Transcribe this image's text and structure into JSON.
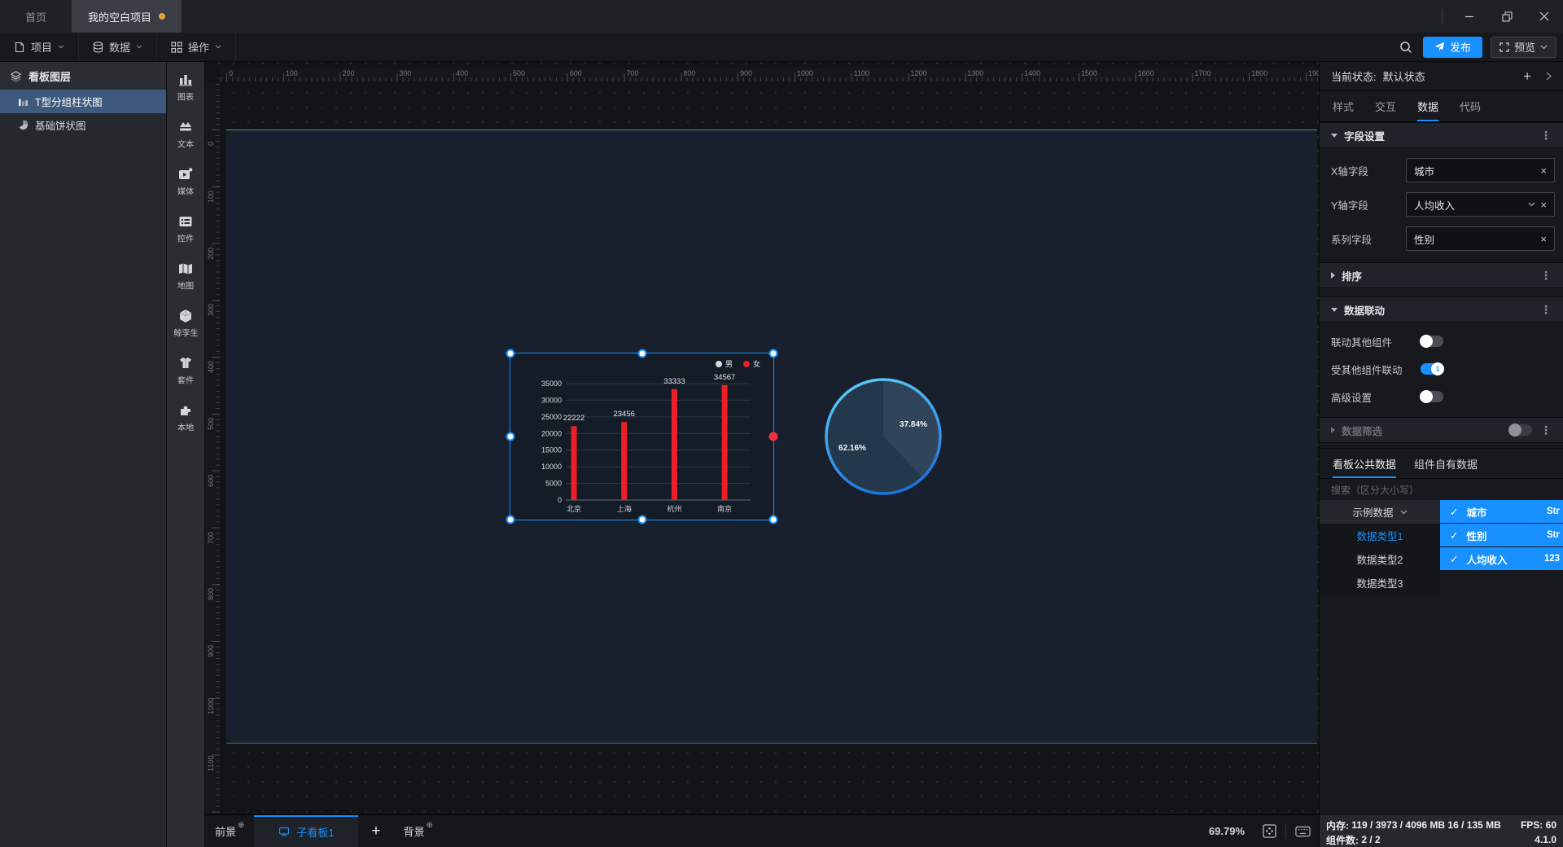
{
  "titlebar": {
    "home_tab": "首页",
    "project_tab": "我的空白项目"
  },
  "menubar": {
    "items": [
      {
        "key": "project",
        "label": "项目"
      },
      {
        "key": "data",
        "label": "数据"
      },
      {
        "key": "ops",
        "label": "操作"
      }
    ],
    "publish": "发布",
    "preview": "预览"
  },
  "layers_panel": {
    "title": "看板图层",
    "items": [
      {
        "label": "T型分组柱状图",
        "selected": true
      },
      {
        "label": "基础饼状图",
        "selected": false
      }
    ]
  },
  "component_strip": {
    "items": [
      {
        "key": "chart",
        "label": "图表"
      },
      {
        "key": "text",
        "label": "文本"
      },
      {
        "key": "media",
        "label": "媒体"
      },
      {
        "key": "control",
        "label": "控件"
      },
      {
        "key": "map",
        "label": "地图"
      },
      {
        "key": "twin",
        "label": "鲸孪生"
      },
      {
        "key": "kit",
        "label": "套件"
      },
      {
        "key": "local",
        "label": "本地"
      }
    ]
  },
  "canvas": {
    "ruler_h": {
      "start": 0,
      "end": 1900,
      "step": 100
    },
    "ruler_v": {
      "start": 0,
      "end": 1100,
      "step": 100
    },
    "scale": 0.6979
  },
  "chart_data": [
    {
      "type": "bar",
      "categories": [
        "北京",
        "上海",
        "杭州",
        "南京"
      ],
      "series": [
        {
          "name": "男",
          "color": "#d9d9d9",
          "values": []
        },
        {
          "name": "女",
          "color": "#ec1e28",
          "values": [
            22222,
            23456,
            33333,
            34567
          ]
        }
      ],
      "ylim": [
        0,
        35000
      ],
      "ytick_step": 5000,
      "legend_position": "top-right",
      "grid": true,
      "title": "",
      "xlabel": "",
      "ylabel": ""
    },
    {
      "type": "pie",
      "start_angle": -90,
      "slices": [
        {
          "label": "37.84%",
          "value": 37.84,
          "color": "#30455a"
        },
        {
          "label": "62.16%",
          "value": 62.16,
          "color": "#24384c"
        }
      ],
      "ring_gradient": [
        "#5dcdf6",
        "#1d74dd"
      ]
    }
  ],
  "board_bar": {
    "foreground": "前景",
    "active_tab": "子看板1",
    "add": "+",
    "background": "背景",
    "zoom": "69.79%"
  },
  "inspector": {
    "state": {
      "label": "当前状态:",
      "value": "默认状态"
    },
    "tabs": [
      {
        "label": "样式"
      },
      {
        "label": "交互"
      },
      {
        "label": "数据",
        "active": true
      },
      {
        "label": "代码"
      }
    ],
    "field_section": {
      "title": "字段设置",
      "fields": [
        {
          "label": "X轴字段",
          "value": "城市",
          "has_dropdown": false
        },
        {
          "label": "Y轴字段",
          "value": "人均收入",
          "has_dropdown": true
        },
        {
          "label": "系列字段",
          "value": "性别",
          "has_dropdown": false
        }
      ]
    },
    "sort_section": {
      "title": "排序"
    },
    "linkage_section": {
      "title": "数据联动",
      "toggles": [
        {
          "label": "联动其他组件",
          "on": false
        },
        {
          "label": "受其他组件联动",
          "on": true,
          "badge": "1"
        },
        {
          "label": "高级设置",
          "on": false
        }
      ]
    },
    "filter_section": {
      "title": "数据筛选",
      "disabled": true,
      "on": false
    },
    "data_tabs": [
      {
        "label": "看板公共数据",
        "active": true
      },
      {
        "label": "组件自有数据"
      }
    ],
    "search_placeholder": "搜索（区分大小写）",
    "data_browser": {
      "dataset": "示例数据",
      "types": [
        {
          "label": "数据类型1",
          "selected": true
        },
        {
          "label": "数据类型2",
          "selected": false
        },
        {
          "label": "数据类型3",
          "selected": false
        }
      ],
      "fields": [
        {
          "name": "城市",
          "type": "Str",
          "checked": true
        },
        {
          "name": "性别",
          "type": "Str",
          "checked": true
        },
        {
          "name": "人均收入",
          "type": "123",
          "checked": true
        }
      ]
    }
  },
  "status_bar": {
    "memory_label": "内存:",
    "memory_value": "119 / 3973 / 4096 MB  16 / 135 MB",
    "fps_label": "FPS:",
    "fps_value": "60",
    "components_label": "组件数:",
    "components_value": "2 / 2",
    "version": "4.1.0"
  }
}
